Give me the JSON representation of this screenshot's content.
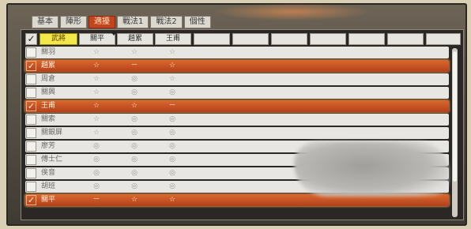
{
  "tabs": [
    {
      "label": "基本",
      "active": false
    },
    {
      "label": "陣形",
      "active": false
    },
    {
      "label": "適擾",
      "active": true
    },
    {
      "label": "戰法1",
      "active": false
    },
    {
      "label": "戰法2",
      "active": false
    },
    {
      "label": "個性",
      "active": false
    }
  ],
  "table": {
    "header_check": "✓",
    "columns": [
      "武將",
      "關平",
      "趙累",
      "王甫",
      "",
      "",
      "",
      "",
      "",
      "",
      ""
    ],
    "rows": [
      {
        "selected": false,
        "check": "",
        "name": "關羽",
        "marks": [
          "☆",
          "☆",
          "☆"
        ]
      },
      {
        "selected": true,
        "check": "✓",
        "name": "趙累",
        "marks": [
          "☆",
          "－",
          "☆"
        ]
      },
      {
        "selected": false,
        "check": "",
        "name": "周倉",
        "marks": [
          "☆",
          "◎",
          "☆"
        ]
      },
      {
        "selected": false,
        "check": "",
        "name": "關興",
        "marks": [
          "☆",
          "◎",
          "◎"
        ]
      },
      {
        "selected": true,
        "check": "✓",
        "name": "王甫",
        "marks": [
          "☆",
          "☆",
          "－"
        ]
      },
      {
        "selected": false,
        "check": "",
        "name": "關索",
        "marks": [
          "☆",
          "◎",
          "◎"
        ]
      },
      {
        "selected": false,
        "check": "",
        "name": "關銀屏",
        "marks": [
          "☆",
          "◎",
          "◎"
        ]
      },
      {
        "selected": false,
        "check": "",
        "name": "廖芳",
        "marks": [
          "◎",
          "◎",
          "◎"
        ]
      },
      {
        "selected": false,
        "check": "",
        "name": "傅士仁",
        "marks": [
          "◎",
          "◎",
          "◎"
        ]
      },
      {
        "selected": false,
        "check": "",
        "name": "俟音",
        "marks": [
          "◎",
          "◎",
          "◎"
        ]
      },
      {
        "selected": false,
        "check": "",
        "name": "胡班",
        "marks": [
          "◎",
          "◎",
          "◎"
        ]
      },
      {
        "selected": true,
        "check": "✓",
        "name": "關平",
        "marks": [
          "－",
          "☆",
          "☆"
        ]
      }
    ]
  },
  "colors": {
    "accent": "#c4441e",
    "header_active": "#f3e84a",
    "row_bg": "#e8e6e2"
  }
}
